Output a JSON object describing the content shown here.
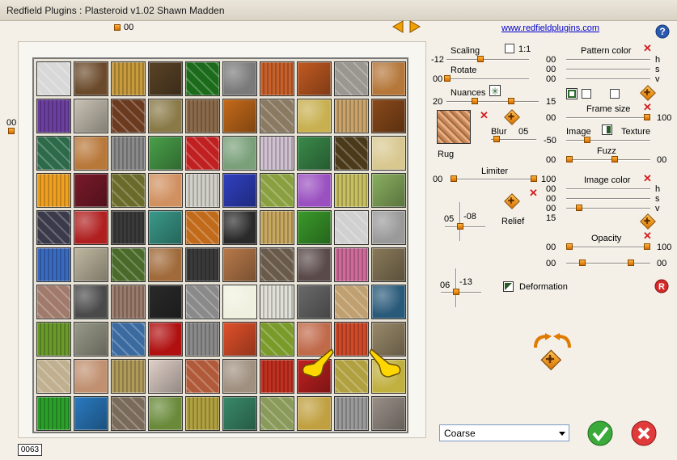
{
  "window": {
    "title": "Redfield Plugins : Plasteroid v1.02   Shawn Madden"
  },
  "top_counter": "00",
  "left_counter": "00",
  "link": "www.redfieldplugins.com",
  "help_icon": "?",
  "scaling": {
    "label": "Scaling",
    "one_to_one": "1:1",
    "value": "-12",
    "fraction": 0.3
  },
  "rotate": {
    "label": "Rotate",
    "value": "00",
    "fraction": 0.0
  },
  "nuances": {
    "label": "Nuances",
    "left": "20",
    "right": "15"
  },
  "rug": {
    "label": "Rug"
  },
  "blur": {
    "label": "Blur",
    "value": "05"
  },
  "limiter": {
    "label": "Limiter",
    "left": "00",
    "right": "100"
  },
  "relief": {
    "label": "Relief",
    "left": "05",
    "right": "-08"
  },
  "deformation": {
    "label": "Deformation",
    "left": "06",
    "right": "-13"
  },
  "pattern_color": {
    "label": "Pattern color",
    "rows": [
      {
        "value": "00",
        "ch": "h"
      },
      {
        "value": "00",
        "ch": "s"
      },
      {
        "value": "00",
        "ch": "v"
      }
    ]
  },
  "frame_size": {
    "label": "Frame size",
    "left": "00",
    "right": "100"
  },
  "image_texture": {
    "image": "Image",
    "texture": "Texture",
    "value": "-50"
  },
  "fuzz": {
    "label": "Fuzz",
    "left": "00",
    "right": "00"
  },
  "image_color": {
    "label": "Image color",
    "rows": [
      {
        "value": "00",
        "ch": "h"
      },
      {
        "value": "00",
        "ch": "s"
      },
      {
        "value": "00",
        "ch": "v"
      }
    ],
    "extra": "15"
  },
  "opacity": {
    "label": "Opacity",
    "left": "00",
    "right": "100",
    "left2": "00",
    "right2": "00"
  },
  "reset_icon": "R",
  "dropdown": {
    "value": "Coarse"
  },
  "counter": "0063",
  "colors": {
    "accent": "#e07a00",
    "ok": "#2e9e2e",
    "cancel": "#d42a2a"
  },
  "tiles": [
    "#d8d8d8",
    "#6b4a2b",
    "#c79a3c",
    "#5a4326",
    "#1b6b1b",
    "#7a7a7a",
    "#c7602a",
    "#c25a22",
    "#9a9690",
    "#b5773a",
    "#6b3fa0",
    "#c9c2b4",
    "#6b3a1f",
    "#8a7a48",
    "#8a6a4a",
    "#c46a1a",
    "#8a7a62",
    "#c8b050",
    "#c9a36a",
    "#8a4a1a",
    "#2c6a4a",
    "#b8783a",
    "#8a8a8a",
    "#4aa04a",
    "#c02020",
    "#7aa07a",
    "#d0c0d0",
    "#3a8a4a",
    "#4a3a1a",
    "#d8c890",
    "#f0a020",
    "#7a1a2a",
    "#6a6a2a",
    "#d09060",
    "#d0d0c8",
    "#3040c0",
    "#8aa040",
    "#9a50c0",
    "#c8c060",
    "#8ab060",
    "#3a3a4a",
    "#b02020",
    "#3a3a3a",
    "#3a9a8a",
    "#c06a1a",
    "#2a2a2a",
    "#c8a860",
    "#3a9a2a",
    "#d0d0d0",
    "#9a9a9a",
    "#3a6ac0",
    "#c0b8a0",
    "#4a6a2a",
    "#a06a3a",
    "#3a3a3a",
    "#b87a4a",
    "#6a5a4a",
    "#5a4a4a",
    "#d06a9a",
    "#8a7a5a",
    "#a07a6a",
    "#4a4a4a",
    "#9a7a6a",
    "#2a2a2a",
    "#8a8a8a",
    "#f0f0e0",
    "#e0e0d8",
    "#6a6a6a",
    "#c0a070",
    "#2a5a7a",
    "#6a9a2a",
    "#9a9a8a",
    "#3a6aa0",
    "#b01010",
    "#8a8a8a",
    "#e0502a",
    "#7a9a2a",
    "#c06a4a",
    "#d04a2a",
    "#9a8a6a",
    "#c0b090",
    "#c09070",
    "#b09a5a",
    "#e0d0c8",
    "#b05a3a",
    "#a09080",
    "#c03020",
    "#c02020",
    "#b0a040",
    "#c0b040",
    "#2aa02a",
    "#2a7ac0",
    "#7a6a5a",
    "#6a8a3a",
    "#b0a040",
    "#3a8a6a",
    "#8a9a5a",
    "#c0a040",
    "#9a9a9a",
    "#9a9088"
  ]
}
